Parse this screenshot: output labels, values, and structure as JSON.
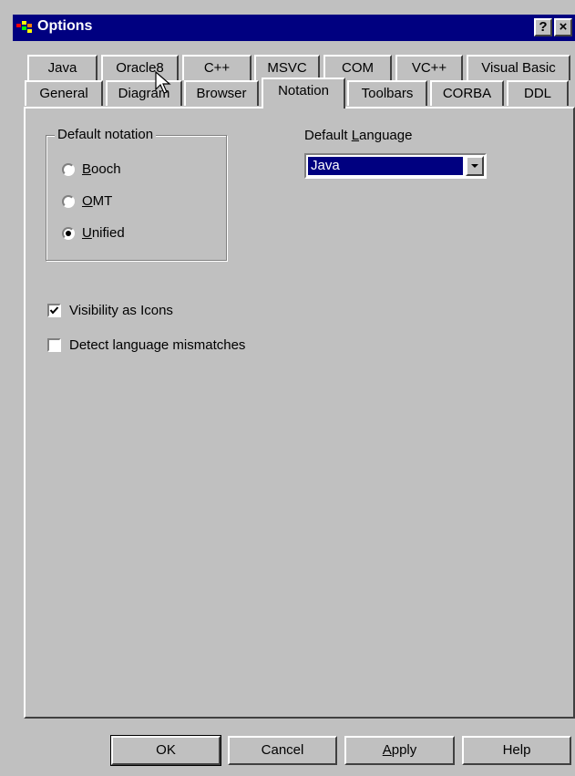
{
  "window": {
    "title": "Options",
    "help_btn": "?",
    "close_btn": "×"
  },
  "tabs_row1": [
    "Java",
    "Oracle8",
    "C++",
    "MSVC",
    "COM",
    "VC++",
    "Visual Basic"
  ],
  "tabs_row2": [
    "General",
    "Diagram",
    "Browser",
    "Notation",
    "Toolbars",
    "CORBA",
    "DDL"
  ],
  "active_tab": "Notation",
  "notation": {
    "group_label": "Default notation",
    "options": [
      {
        "pre": "",
        "ul": "B",
        "post": "ooch",
        "selected": false
      },
      {
        "pre": "",
        "ul": "O",
        "post": "MT",
        "selected": false
      },
      {
        "pre": "",
        "ul": "U",
        "post": "nified",
        "selected": true
      }
    ]
  },
  "language": {
    "label_pre": "Default ",
    "label_ul": "L",
    "label_post": "anguage",
    "value": "Java"
  },
  "checkboxes": [
    {
      "label": "Visibility as Icons",
      "checked": true
    },
    {
      "label": "Detect language mismatches",
      "checked": false
    }
  ],
  "buttons": {
    "ok": "OK",
    "cancel": "Cancel",
    "apply_ul": "A",
    "apply_post": "pply",
    "help": "Help"
  }
}
